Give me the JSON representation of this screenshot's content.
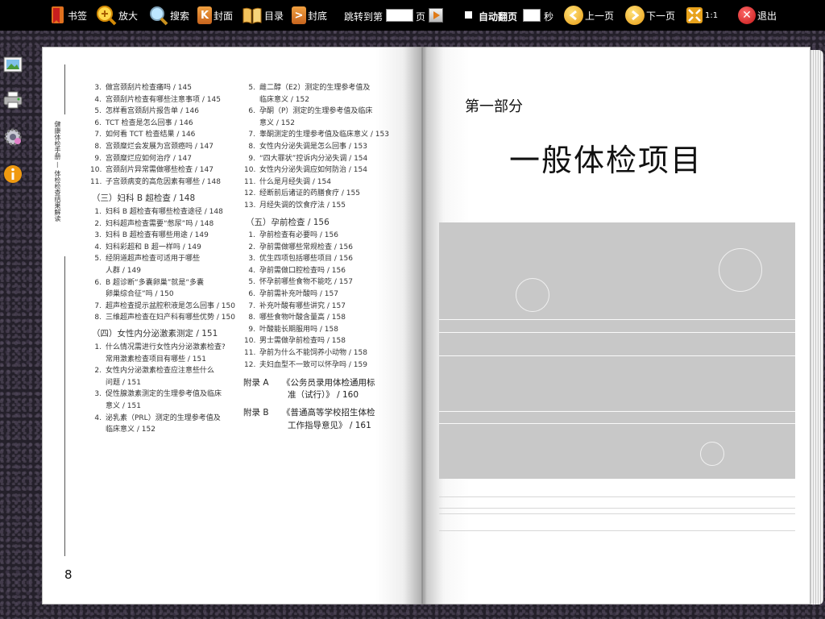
{
  "toolbar": {
    "bookmark": "书签",
    "zoom": "放大",
    "search": "搜索",
    "cover": "封面",
    "toc": "目录",
    "back_cover": "封底",
    "jump_to": "跳转到第",
    "page_unit": "页",
    "auto_flip": "自动翻页",
    "seconds_unit": "秒",
    "prev": "上一页",
    "next": "下一页",
    "ratio": "1:1",
    "exit": "退出"
  },
  "left_page": {
    "side_title": "健康体检手册 — 体检检查结果解读",
    "page_number": "8",
    "col1_top": [
      {
        "n": "3.",
        "t": "做宫颈刮片检查痛吗 / 145"
      },
      {
        "n": "4.",
        "t": "宫颈刮片检查有哪些注意事项 / 145"
      },
      {
        "n": "5.",
        "t": "怎样看宫颈刮片报告单 / 146"
      },
      {
        "n": "6.",
        "t": "TCT 检查是怎么回事 / 146"
      },
      {
        "n": "7.",
        "t": "如何看 TCT 检查结果 / 146"
      },
      {
        "n": "8.",
        "t": "宫颈糜烂会发展为宫颈癌吗 / 147"
      },
      {
        "n": "9.",
        "t": "宫颈糜烂应如何治疗 / 147"
      },
      {
        "n": "10.",
        "t": "宫颈刮片异常需做哪些检查 / 147"
      },
      {
        "n": "11.",
        "t": "子宫颈病变的高危因素有哪些 / 148"
      }
    ],
    "sec3": "（三）妇科 B 超检查 / 148",
    "col1_mid": [
      {
        "n": "1.",
        "t": "妇科 B 超检查有哪些检查途径 / 148"
      },
      {
        "n": "2.",
        "t": "妇科超声检查需要“憋尿”吗 / 148"
      },
      {
        "n": "3.",
        "t": "妇科 B 超检查有哪些用途 / 149"
      },
      {
        "n": "4.",
        "t": "妇科彩超和 B 超一样吗 / 149"
      },
      {
        "n": "5.",
        "t": "经阴道超声检查可适用于哪些"
      },
      {
        "n": "",
        "t": "人群 / 149"
      },
      {
        "n": "6.",
        "t": "B 超诊断“多囊卵巢”就是“多囊"
      },
      {
        "n": "",
        "t": "卵巢综合征”吗 / 150"
      },
      {
        "n": "7.",
        "t": "超声检查提示盆腔积液是怎么回事 / 150"
      },
      {
        "n": "8.",
        "t": "三维超声检查在妇产科有哪些优势 / 150"
      }
    ],
    "sec4": "（四）女性内分泌激素测定 / 151",
    "col1_bottom": [
      {
        "n": "1.",
        "t": "什么情况需进行女性内分泌激素检查?"
      },
      {
        "n": "",
        "t": "常用激素检查项目有哪些 / 151"
      },
      {
        "n": "2.",
        "t": "女性内分泌激素检查应注意些什么"
      },
      {
        "n": "",
        "t": "问题 / 151"
      },
      {
        "n": "3.",
        "t": "促性腺激素测定的生理参考值及临床"
      },
      {
        "n": "",
        "t": "意义 / 151"
      },
      {
        "n": "4.",
        "t": "泌乳素（PRL）测定的生理参考值及"
      },
      {
        "n": "",
        "t": "临床意义 / 152"
      }
    ],
    "col2_top": [
      {
        "n": "5.",
        "t": "雌二醇（E2）测定的生理参考值及"
      },
      {
        "n": "",
        "t": "临床意义 / 152"
      },
      {
        "n": "6.",
        "t": "孕酮（P）测定的生理参考值及临床"
      },
      {
        "n": "",
        "t": "意义 / 152"
      },
      {
        "n": "7.",
        "t": "睾酮测定的生理参考值及临床意义 / 153"
      },
      {
        "n": "8.",
        "t": "女性内分泌失调是怎么回事 / 153"
      },
      {
        "n": "9.",
        "t": "“四大罪状”控诉内分泌失调 / 154"
      },
      {
        "n": "10.",
        "t": "女性内分泌失调应如何防治 / 154"
      },
      {
        "n": "11.",
        "t": "什么是月经失调 / 154"
      },
      {
        "n": "12.",
        "t": "经断前后诸证的药膳食疗 / 155"
      },
      {
        "n": "13.",
        "t": "月经失调的饮食疗法 / 155"
      }
    ],
    "sec5": "（五）孕前检查 / 156",
    "col2_bottom": [
      {
        "n": "1.",
        "t": "孕前检查有必要吗 / 156"
      },
      {
        "n": "2.",
        "t": "孕前需做哪些常规检查 / 156"
      },
      {
        "n": "3.",
        "t": "优生四项包括哪些项目 / 156"
      },
      {
        "n": "4.",
        "t": "孕前需做口腔检查吗 / 156"
      },
      {
        "n": "5.",
        "t": "怀孕前哪些食物不能吃 / 157"
      },
      {
        "n": "6.",
        "t": "孕前需补充叶酸吗 / 157"
      },
      {
        "n": "7.",
        "t": "补充叶酸有哪些讲究 / 157"
      },
      {
        "n": "8.",
        "t": "哪些食物叶酸含量高 / 158"
      },
      {
        "n": "9.",
        "t": "叶酸能长期服用吗 / 158"
      },
      {
        "n": "10.",
        "t": "男士需做孕前检查吗 / 158"
      },
      {
        "n": "11.",
        "t": "孕前为什么不能饲养小动物 / 158"
      },
      {
        "n": "12.",
        "t": "夫妇血型不一致可以怀孕吗 / 159"
      }
    ],
    "appendix_a_label": "附录 A",
    "appendix_a_line1": "《公务员录用体检通用标",
    "appendix_a_line2": "准（试行）》 / 160",
    "appendix_b_label": "附录 B",
    "appendix_b_line1": "《普通高等学校招生体检",
    "appendix_b_line2": "工作指导意见》 / 161"
  },
  "right_page": {
    "part_label": "第一部分",
    "part_title": "一般体检项目"
  },
  "colors": {
    "toolbar_bg": "#000000",
    "panel_gray": "#c8c8c8",
    "accent_orange": "#e89a10",
    "exit_red": "#c41515"
  }
}
